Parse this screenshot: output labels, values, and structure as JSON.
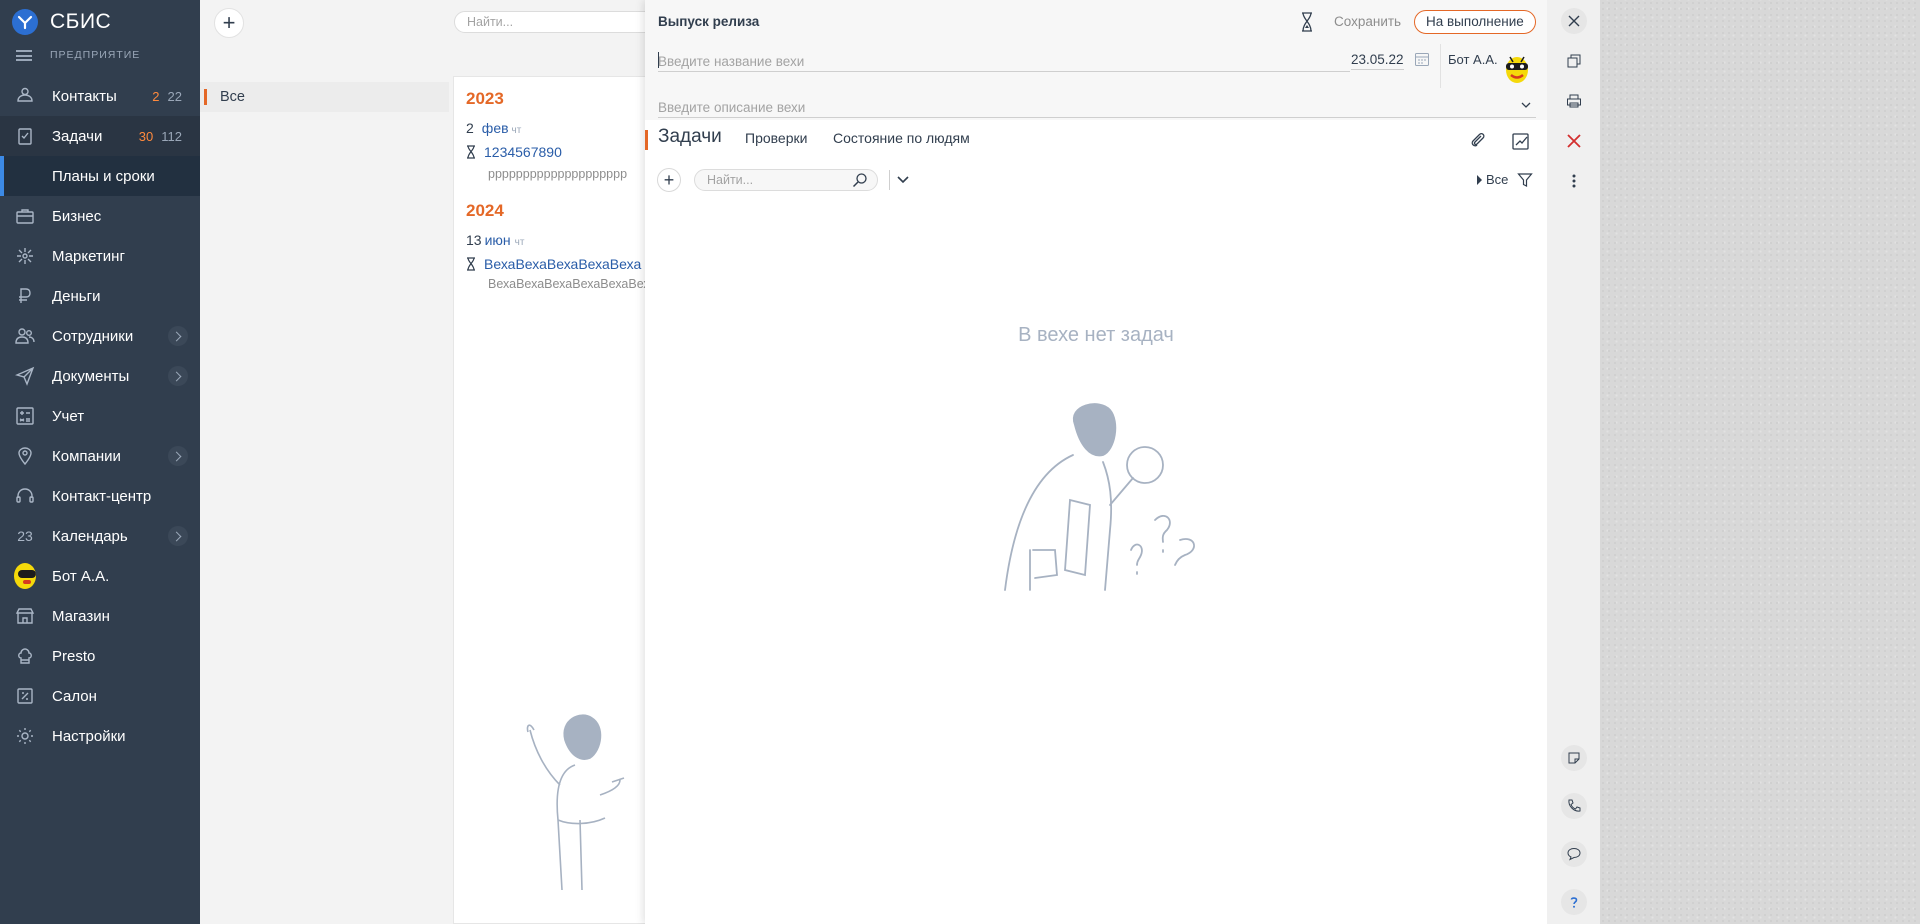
{
  "app": {
    "logo_text": "СБИС",
    "org_label": "ПРЕДПРИЯТИЕ"
  },
  "sidebar": {
    "items": [
      {
        "label": "Контакты",
        "icon": "contacts-icon",
        "count_new": "2",
        "count_all": "22"
      },
      {
        "label": "Задачи",
        "icon": "tasks-icon",
        "count_new": "30",
        "count_all": "112"
      },
      {
        "label": "Планы и сроки",
        "icon": "",
        "sub": true
      },
      {
        "label": "Бизнес",
        "icon": "briefcase-icon"
      },
      {
        "label": "Маркетинг",
        "icon": "marketing-icon"
      },
      {
        "label": "Деньги",
        "icon": "ruble-icon"
      },
      {
        "label": "Сотрудники",
        "icon": "people-icon",
        "has_chevron": true
      },
      {
        "label": "Документы",
        "icon": "paper-plane-icon",
        "has_chevron": true
      },
      {
        "label": "Учет",
        "icon": "calculator-icon"
      },
      {
        "label": "Компании",
        "icon": "location-icon",
        "has_chevron": true
      },
      {
        "label": "Контакт-центр",
        "icon": "headset-icon"
      },
      {
        "label": "Календарь",
        "icon": "calendar-icon",
        "calendar_day": "23",
        "has_chevron": true
      },
      {
        "label": "Бот А.А.",
        "icon": "avatar"
      },
      {
        "label": "Магазин",
        "icon": "store-icon"
      },
      {
        "label": "Presto",
        "icon": "chef-icon"
      },
      {
        "label": "Салон",
        "icon": "salon-icon"
      },
      {
        "label": "Настройки",
        "icon": "gear-icon"
      }
    ]
  },
  "main": {
    "search_placeholder": "Найти...",
    "folder_label": "Все",
    "groups": [
      {
        "year": "2023",
        "day": "2",
        "month": "фев",
        "dow": "чт",
        "title": "1234567890",
        "subtitle": "рррррррррррррррррррр"
      },
      {
        "year": "2024",
        "day": "13",
        "month": "июн",
        "dow": "чт",
        "title": "ВехаВехаВехаВехаВеха",
        "subtitle": "ВехаВехаВехаВехаВехаВеха"
      }
    ]
  },
  "card": {
    "title": "Выпуск релиза",
    "save_label": "Сохранить",
    "status_label": "На выполнение",
    "name_placeholder": "Введите название вехи",
    "date_value": "23.05.22",
    "owner_name": "Бот А.А.",
    "desc_placeholder": "Введите описание вехи",
    "tabs": [
      {
        "label": "Задачи",
        "active": true
      },
      {
        "label": "Проверки"
      },
      {
        "label": "Состояние по людям"
      }
    ],
    "toolbar": {
      "search_placeholder": "Найти...",
      "filter_label": "Все"
    },
    "empty_text": "В вехе нет задач"
  },
  "colors": {
    "sidebar_bg": "#313e4e",
    "accent": "#e46827",
    "link": "#2a5da8",
    "active_marker": "#3c8ae6"
  }
}
